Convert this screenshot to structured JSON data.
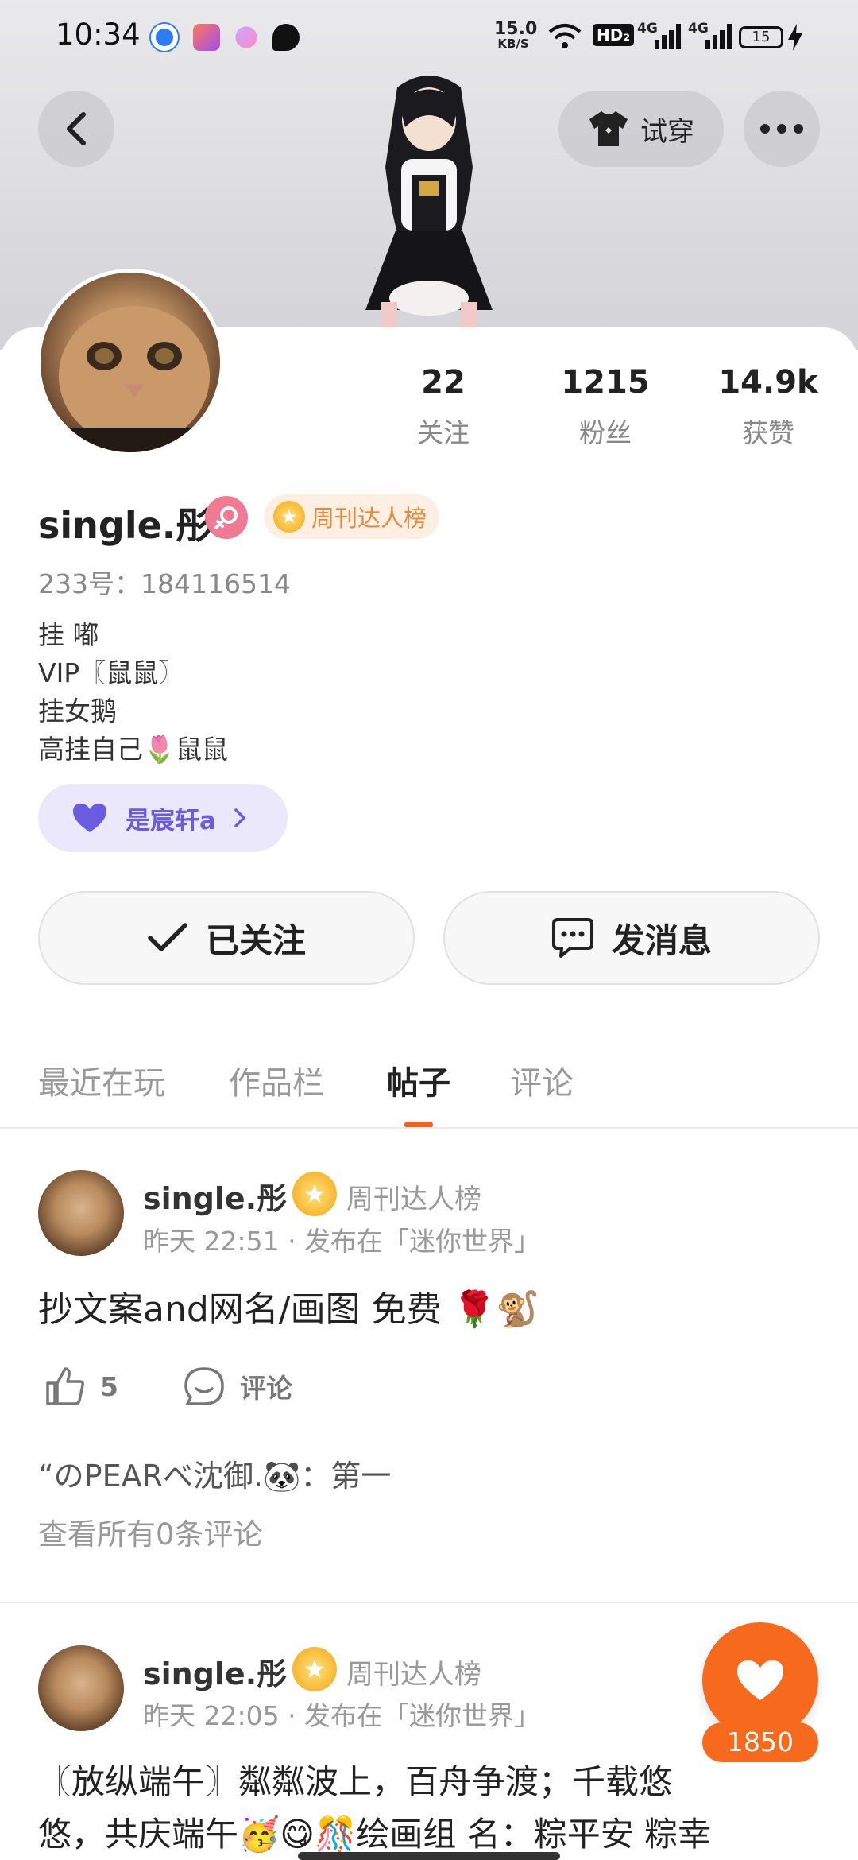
{
  "status_bar": {
    "time": "10:34",
    "net_speed_top": "15.0",
    "net_speed_unit": "KB/S",
    "hd": "HD₂",
    "sig1": "4G",
    "sig2": "4G",
    "battery": "15"
  },
  "header": {
    "back_icon": "chevron-left-icon",
    "tryon_label": "试穿",
    "more_icon": "more-dots-icon"
  },
  "profile": {
    "stats": [
      {
        "value": "22",
        "label": "关注"
      },
      {
        "value": "1215",
        "label": "粉丝"
      },
      {
        "value": "14.9k",
        "label": "获赞"
      }
    ],
    "username": "single.彤",
    "badge": "周刊达人榜",
    "uid": "233号：184116514",
    "bio": [
      "挂 嘟",
      "VIP〖鼠鼠〗",
      "挂女鹅",
      "高挂自己🌷鼠鼠"
    ],
    "fan_tag": "是宸轩a"
  },
  "actions": {
    "follow_label": "已关注",
    "message_label": "发消息"
  },
  "tabs": [
    "最近在玩",
    "作品栏",
    "帖子",
    "评论"
  ],
  "posts": [
    {
      "name": "single.彤",
      "badge": "周刊达人榜",
      "time": "昨天 22:51 · 发布在「迷你世界」",
      "text": "抄文案and网名/画图 免费 🌹🐒",
      "likes": "5",
      "comment_label": "评论",
      "top_comment": "“のPEARべ沈御.🐼：第一",
      "see_all": "查看所有0条评论"
    },
    {
      "name": "single.彤",
      "badge": "周刊达人榜",
      "time": "昨天 22:05 · 发布在「迷你世界」",
      "text_line1": "〖放纵端午〗粼粼波上，百舟争渡；千载悠",
      "text_line2": "悠，共庆端午🥳😋🎊绘画组  名：粽平安 粽幸"
    }
  ],
  "like_fab": {
    "count": "1850"
  },
  "colors": {
    "accent": "#f76a1e",
    "badge_text": "#e8883a",
    "fan_tag": "#6a5be0",
    "gender": "#f07a93"
  }
}
